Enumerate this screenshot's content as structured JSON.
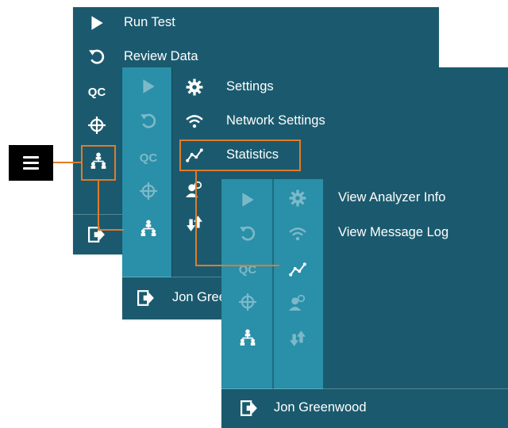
{
  "panel1": {
    "menu": [
      {
        "icon": "play-icon",
        "label": "Run Test"
      },
      {
        "icon": "undo-icon",
        "label": "Review Data"
      },
      {
        "icon": "qc-icon",
        "label": "QC"
      },
      {
        "icon": "crosshair-icon",
        "label": ""
      },
      {
        "icon": "org-chart-icon",
        "label": ""
      }
    ],
    "footer": {
      "icon": "logout-icon"
    }
  },
  "panel2": {
    "menu": [
      {
        "icon": "gear-icon",
        "label": "Settings"
      },
      {
        "icon": "wifi-icon",
        "label": "Network Settings"
      },
      {
        "icon": "statistics-icon",
        "label": "Statistics"
      },
      {
        "icon": "users-icon",
        "label": ""
      },
      {
        "icon": "transfer-icon",
        "label": ""
      }
    ],
    "footer": {
      "icon": "logout-icon",
      "user": "Jon Gree"
    }
  },
  "panel3": {
    "menu": [
      {
        "icon": "info-icon",
        "label": "View Analyzer Info"
      },
      {
        "icon": "log-icon",
        "label": "View Message Log"
      }
    ],
    "footer": {
      "icon": "logout-icon",
      "user": "Jon Greenwood"
    }
  },
  "colors": {
    "panel": "#1b5a6e",
    "rail": "#2a8fa8",
    "highlight": "#e07b2a"
  }
}
